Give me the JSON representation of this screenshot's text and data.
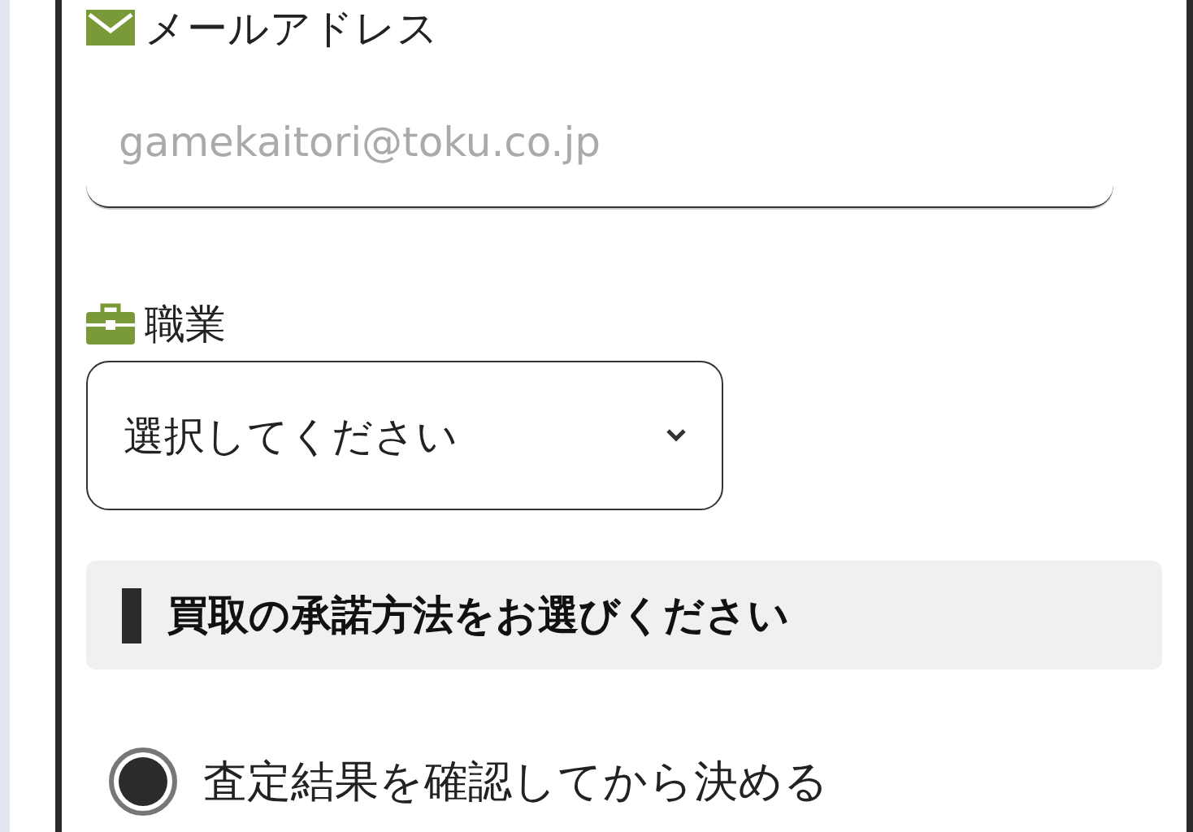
{
  "email_field": {
    "label": "メールアドレス",
    "placeholder": "gamekaitori@toku.co.jp"
  },
  "occupation_field": {
    "label": "職業",
    "value": "選択してください"
  },
  "acceptance_section": {
    "heading": "買取の承諾方法をお選びください",
    "options": [
      {
        "label": "査定結果を確認してから決める",
        "selected": true
      }
    ]
  }
}
